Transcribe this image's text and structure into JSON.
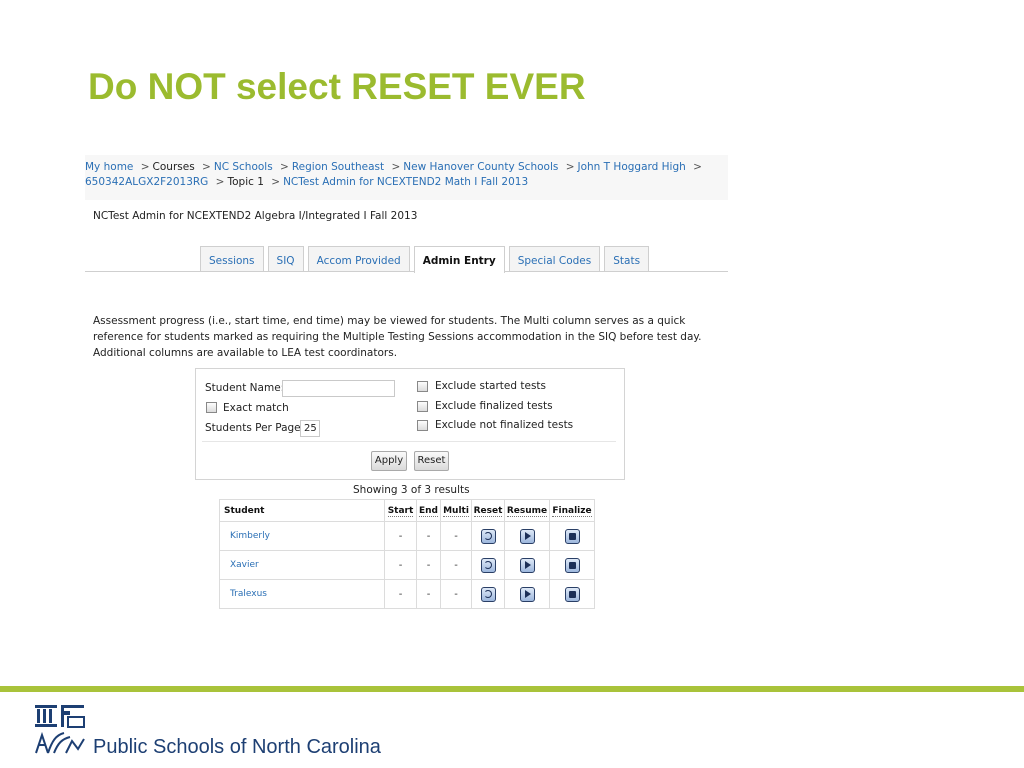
{
  "slide_title": "Do NOT select RESET EVER",
  "breadcrumb": {
    "line1": [
      {
        "label": "My home",
        "link": true
      },
      {
        "label": "Courses",
        "link": false
      },
      {
        "label": "NC Schools",
        "link": true
      },
      {
        "label": "Region Southeast",
        "link": true
      },
      {
        "label": "New Hanover County Schools",
        "link": true
      },
      {
        "label": "John T Hoggard High",
        "link": true
      }
    ],
    "line2": [
      {
        "label": "650342ALGX2F2013RG",
        "link": true
      },
      {
        "label": "Topic 1",
        "link": false
      },
      {
        "label": "NCTest Admin for NCEXTEND2 Math I Fall 2013",
        "link": true
      }
    ],
    "separator": ">"
  },
  "course_title": "NCTest Admin for NCEXTEND2 Algebra I/Integrated I Fall 2013",
  "tabs": [
    {
      "label": "Sessions",
      "active": false
    },
    {
      "label": "SIQ",
      "active": false
    },
    {
      "label": "Accom Provided",
      "active": false
    },
    {
      "label": "Admin Entry",
      "active": true
    },
    {
      "label": "Special Codes",
      "active": false
    },
    {
      "label": "Stats",
      "active": false
    }
  ],
  "description": "Assessment progress (i.e., start time, end time) may be viewed for students. The Multi column serves as a quick reference for students marked as requiring the Multiple Testing Sessions accommodation in the SIQ before test day. Additional columns are available to LEA test coordinators.",
  "filters": {
    "student_name_label": "Student Name:",
    "student_name_value": "",
    "exact_match_label": "Exact match",
    "students_per_page_label": "Students Per Page:",
    "students_per_page_value": "25",
    "exclude_started_label": "Exclude started tests",
    "exclude_finalized_label": "Exclude finalized tests",
    "exclude_not_finalized_label": "Exclude not finalized tests",
    "apply_label": "Apply",
    "reset_label": "Reset"
  },
  "results_summary": "Showing 3 of 3 results",
  "table": {
    "headers": {
      "student": "Student",
      "start": "Start",
      "end": "End",
      "multi": "Multi",
      "reset": "Reset",
      "resume": "Resume",
      "finalize": "Finalize"
    },
    "rows": [
      {
        "student": "Kimberly",
        "start": "-",
        "end": "-",
        "multi": "-"
      },
      {
        "student": "Xavier",
        "start": "-",
        "end": "-",
        "multi": "-"
      },
      {
        "student": "Tralexus",
        "start": "-",
        "end": "-",
        "multi": "-"
      }
    ]
  },
  "icons": {
    "reset": "reset-icon",
    "resume": "play-icon",
    "finalize": "stop-icon"
  },
  "footer": {
    "org_name": "Public Schools of North Carolina"
  },
  "colors": {
    "title_green": "#9bbb2f",
    "footer_bar": "#a9c33a",
    "link_blue": "#2a6fb5",
    "footer_text": "#1d3f73"
  }
}
